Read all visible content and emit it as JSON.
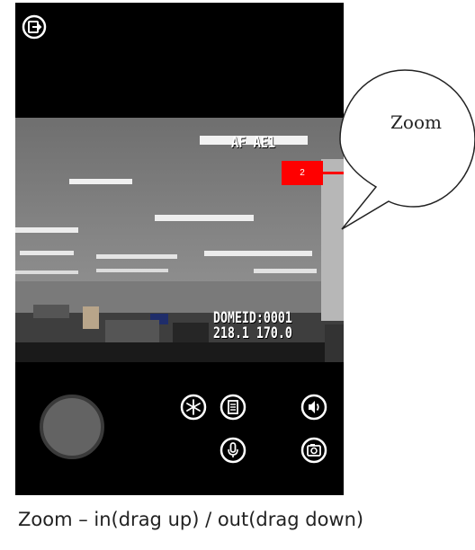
{
  "video": {
    "osd_top": "AF AE1",
    "osd_id_line1": "DOMEID:0001",
    "osd_id_line2": "218.1 170.0"
  },
  "zoom": {
    "level_label": "2",
    "callout_label": "Zoom"
  },
  "caption": "Zoom – in(drag up) / out(drag down)",
  "icons": [
    "exit-icon",
    "freeze-icon",
    "notepad-icon",
    "speaker-icon",
    "microphone-icon",
    "camera-icon"
  ],
  "colors": {
    "zoom_indicator": "#ff0000",
    "zoom_track": "#b7b7b7",
    "phone_bg": "#000000"
  }
}
